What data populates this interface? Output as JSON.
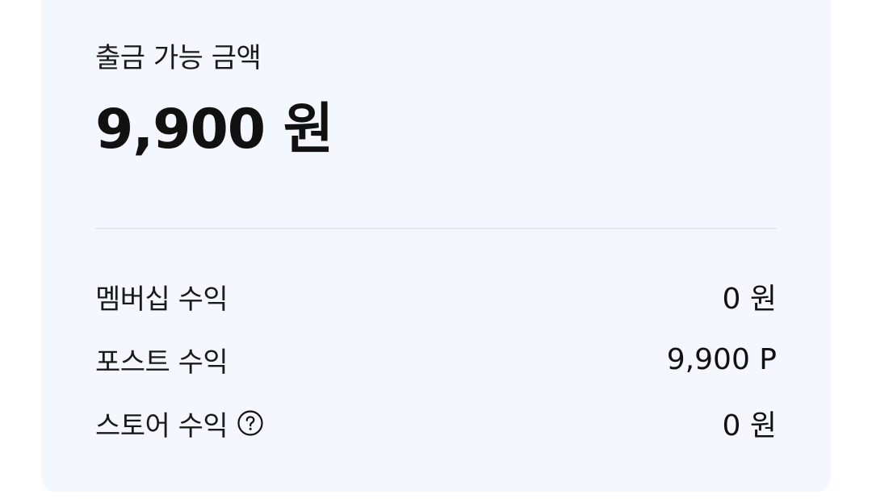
{
  "balance": {
    "label": "출금 가능 금액",
    "amount": "9,900 원"
  },
  "earnings": [
    {
      "label": "멤버십 수익",
      "value": "0 원",
      "has_help_icon": false
    },
    {
      "label": "포스트 수익",
      "value": "9,900 P",
      "has_help_icon": false
    },
    {
      "label": "스토어 수익",
      "value": "0 원",
      "has_help_icon": true,
      "icon": "question-circle-icon"
    }
  ],
  "colors": {
    "card_background": "#f4f7fe",
    "divider": "#e3e7f0",
    "text": "#111111"
  }
}
